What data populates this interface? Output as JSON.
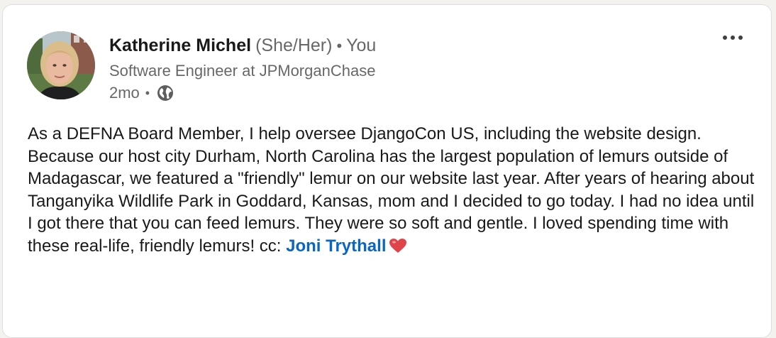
{
  "author": {
    "name": "Katherine Michel",
    "pronouns": "(She/Her)",
    "separator": "•",
    "degree": "You",
    "headline": "Software Engineer at JPMorganChase",
    "time": "2mo",
    "visibility_icon": "globe-icon"
  },
  "menu": {
    "more_icon": "more-horizontal-icon"
  },
  "post": {
    "body": "As a DEFNA Board Member, I help oversee DjangoCon US, including the website design. Because our host city Durham, North Carolina has the largest population of lemurs outside of Madagascar, we featured a \"friendly\" lemur on our website last year. After years of hearing about Tanganyika Wildlife Park in Goddard, Kansas, mom and I decided to go today. I had no idea until I got there that you can feed lemurs. They were so soft and gentle. I loved spending time with these real-life, friendly lemurs! cc: ",
    "mention": "Joni Trythall",
    "end_icon": "red-heart-icon"
  },
  "colors": {
    "link": "#0a66c2",
    "heart": "#e0444b"
  }
}
